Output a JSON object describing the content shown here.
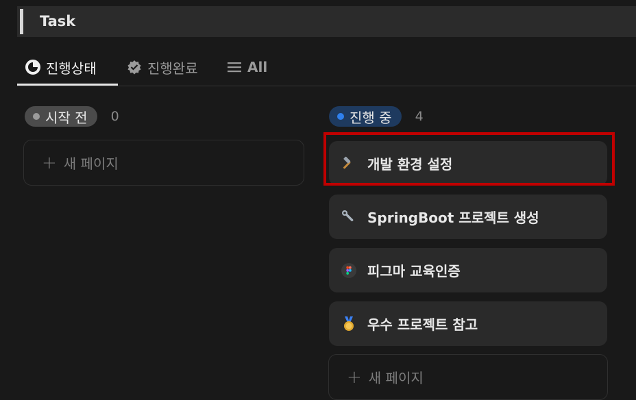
{
  "header": {
    "title": "Task"
  },
  "tabs": [
    {
      "label": "진행상태",
      "icon": "pie-chart-icon",
      "active": true
    },
    {
      "label": "진행완료",
      "icon": "verified-check-icon",
      "active": false
    },
    {
      "label": "All",
      "icon": "list-icon",
      "active": false
    }
  ],
  "columns": [
    {
      "status": "시작 전",
      "count": "0",
      "dot_color": "#9b9b9b",
      "pill_color": "#4b4b4b",
      "new_page_label": "새 페이지",
      "cards": []
    },
    {
      "status": "진행 중",
      "count": "4",
      "dot_color": "#2f80ed",
      "pill_color": "#1e3a5f",
      "new_page_label": "새 페이지",
      "cards": [
        {
          "title": "개발 환경 설정",
          "icon": "hammer-icon",
          "highlighted": true
        },
        {
          "title": "SpringBoot 프로젝트 생성",
          "icon": "wrench-icon"
        },
        {
          "title": "피그마 교육인증",
          "icon": "figma-icon"
        },
        {
          "title": "우수 프로젝트 참고",
          "icon": "medal-icon"
        }
      ]
    }
  ],
  "colors": {
    "background": "#191919",
    "card": "#2a2a2a",
    "highlight": "#c00000"
  }
}
